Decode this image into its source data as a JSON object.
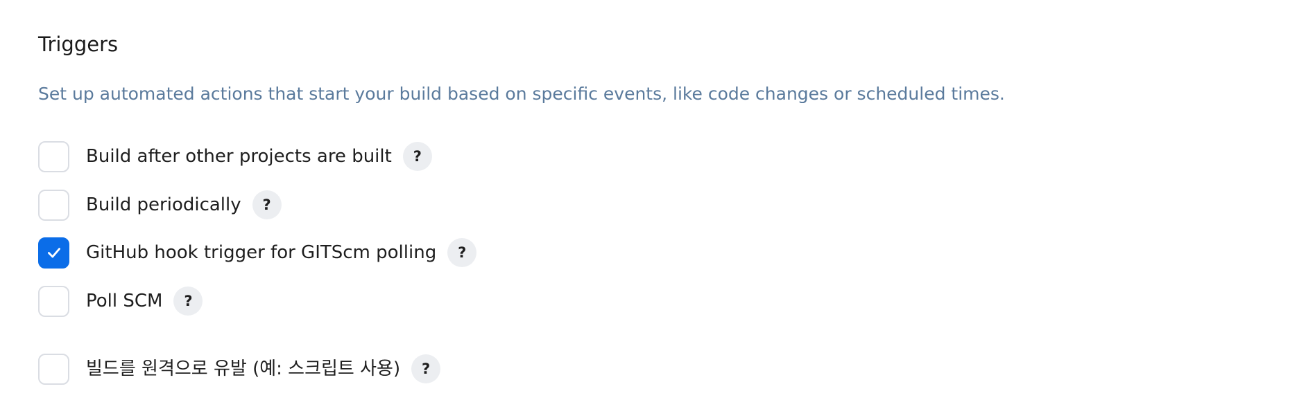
{
  "triggers": {
    "title": "Triggers",
    "description": "Set up automated actions that start your build based on specific events, like code changes or scheduled times.",
    "help_glyph": "?",
    "options": [
      {
        "label": "Build after other projects are built",
        "checked": false
      },
      {
        "label": "Build periodically",
        "checked": false
      },
      {
        "label": "GitHub hook trigger for GITScm polling",
        "checked": true
      },
      {
        "label": "Poll SCM",
        "checked": false
      },
      {
        "label": "빌드를 원격으로 유발 (예: 스크립트 사용)",
        "checked": false
      }
    ]
  },
  "colors": {
    "accent": "#0b6de8",
    "description_text": "#5a7a9c",
    "checkbox_border": "#dadde3",
    "help_background": "#eceef1"
  },
  "icons": {
    "check": "checkmark-icon",
    "help": "help-icon"
  }
}
